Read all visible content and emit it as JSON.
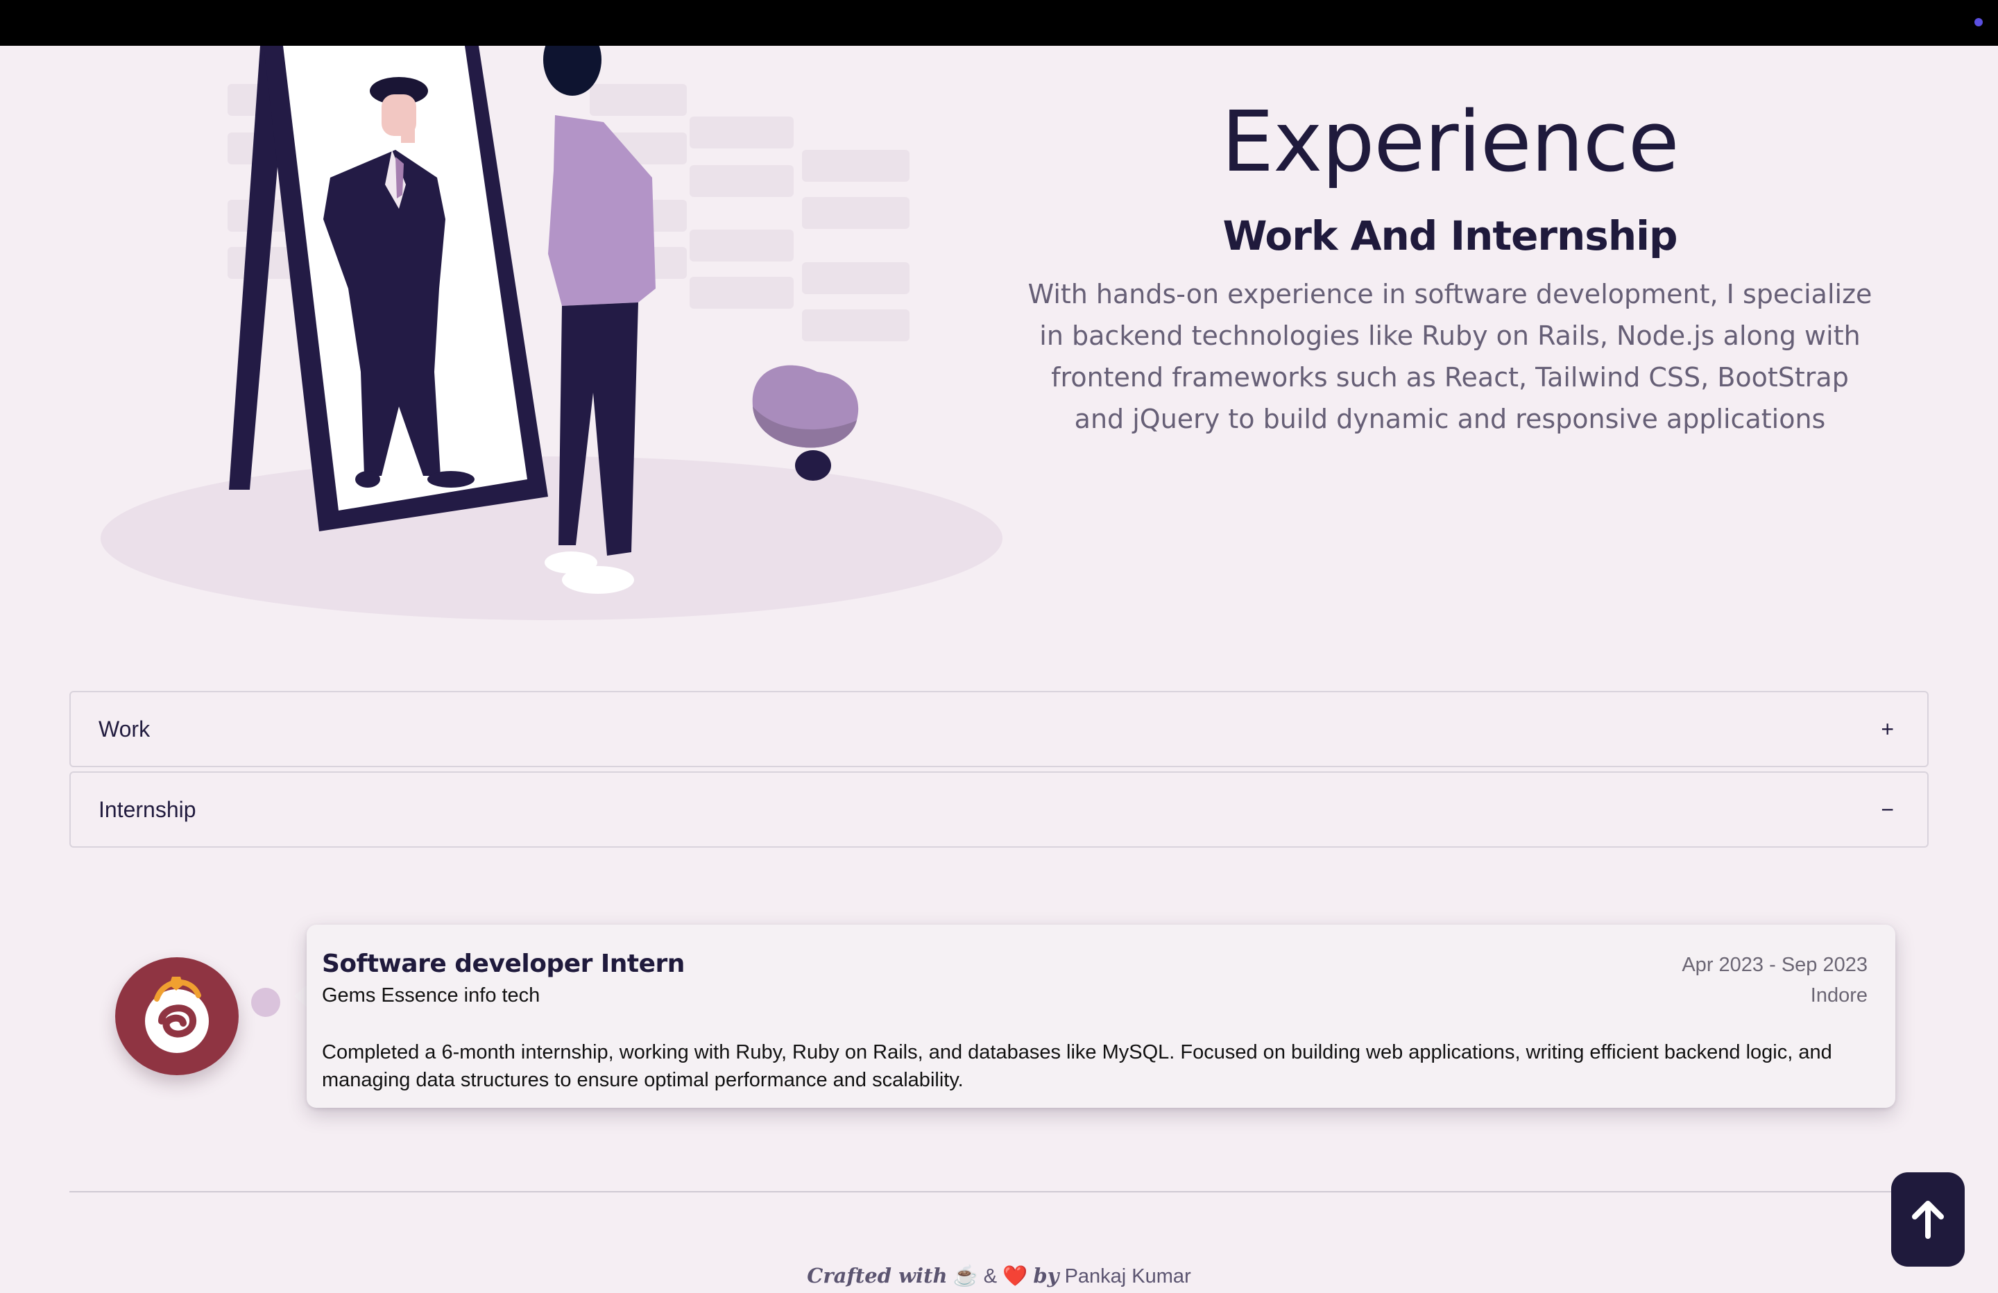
{
  "hero": {
    "title": "Experience",
    "subtitle": "Work And Internship",
    "description": "With hands-on experience in software development, I specialize in backend technologies like Ruby on Rails, Node.js along with frontend frameworks such as React, Tailwind CSS, BootStrap and jQuery to build dynamic and responsive applications"
  },
  "accordion": [
    {
      "label": "Work",
      "toggle": "+"
    },
    {
      "label": "Internship",
      "toggle": "−"
    }
  ],
  "internship": {
    "role": "Software developer Intern",
    "company": "Gems Essence info tech",
    "date": "Apr 2023 - Sep 2023",
    "location": "Indore",
    "description": "Completed a 6-month internship, working with Ruby, Ruby on Rails, and databases like MySQL. Focused on building web applications, writing efficient backend logic, and managing data structures to ensure optimal performance and scalability."
  },
  "footer": {
    "crafted": "Crafted with",
    "coffee": "☕",
    "amp": "&",
    "heart": "❤️",
    "by": "by",
    "author": "Pankaj Kumar"
  },
  "icons": {
    "back_to_top": "arrow-up-icon",
    "company_logo": "gems-essence-logo"
  },
  "colors": {
    "background": "#f5eef3",
    "primary": "#1f1a3c",
    "logo": "#8f3442"
  }
}
